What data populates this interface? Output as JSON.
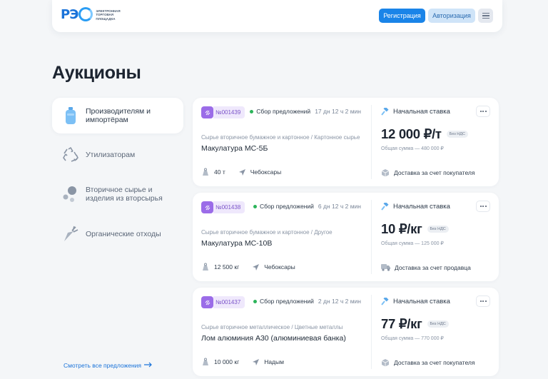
{
  "header": {
    "logo_mark": "РЭ",
    "logo_text": "Электронная торговая площадка",
    "register_label": "Регистрация",
    "auth_label": "Авторизация"
  },
  "page_title": "Аукционы",
  "categories": [
    {
      "label": "Производителям и импортёрам",
      "icon": "bottle-icon",
      "active": true
    },
    {
      "label": "Утилизаторам",
      "icon": "recycle-icon",
      "active": false
    },
    {
      "label": "Вторичное сырье и изделия из вторсырья",
      "icon": "circles-icon",
      "active": false
    },
    {
      "label": "Органические отходы",
      "icon": "carrot-icon",
      "active": false
    }
  ],
  "see_all_label": "Смотреть все предложения",
  "lots": [
    {
      "number": "№001439",
      "status": "Сбор предложений",
      "time_left": "17 дн 12 ч 2 мин",
      "category": "Сырье вторичное бумажное и картонное / Картонное сырье",
      "title": "Макулатура МС-5Б",
      "quantity": "40 т",
      "city": "Чебоксары",
      "rate_label": "Начальная ставка",
      "price": "12 000 ₽/т",
      "vat": "Без НДС",
      "total": "Общая сумма — 480 000 ₽",
      "delivery": "Доставка за счет покупателя",
      "delivery_icon": "box-icon"
    },
    {
      "number": "№001438",
      "status": "Сбор предложений",
      "time_left": "6 дн 12 ч 2 мин",
      "category": "Сырье вторичное бумажное и картонное / Другое",
      "title": "Макулатура МС-10В",
      "quantity": "12 500 кг",
      "city": "Чебоксары",
      "rate_label": "Начальная ставка",
      "price": "10 ₽/кг",
      "vat": "Без НДС",
      "total": "Общая сумма — 125 000 ₽",
      "delivery": "Доставка за счет продавца",
      "delivery_icon": "truck-icon"
    },
    {
      "number": "№001437",
      "status": "Сбор предложений",
      "time_left": "2 дн 12 ч 2 мин",
      "category": "Сырье вторичное металлическое / Цветные металлы",
      "title": "Лом алюминия А30 (алюминиевая банка)",
      "quantity": "10 000 кг",
      "city": "Надым",
      "rate_label": "Начальная ставка",
      "price": "77 ₽/кг",
      "vat": "Без НДС",
      "total": "Общая сумма — 770 000 ₽",
      "delivery": "Доставка за счет покупателя",
      "delivery_icon": "box-icon"
    }
  ],
  "colors": {
    "primary": "#1a84e8",
    "accent_purple": "#9b6ce8",
    "status_green": "#2cb45a",
    "background": "#f4f6f8"
  }
}
